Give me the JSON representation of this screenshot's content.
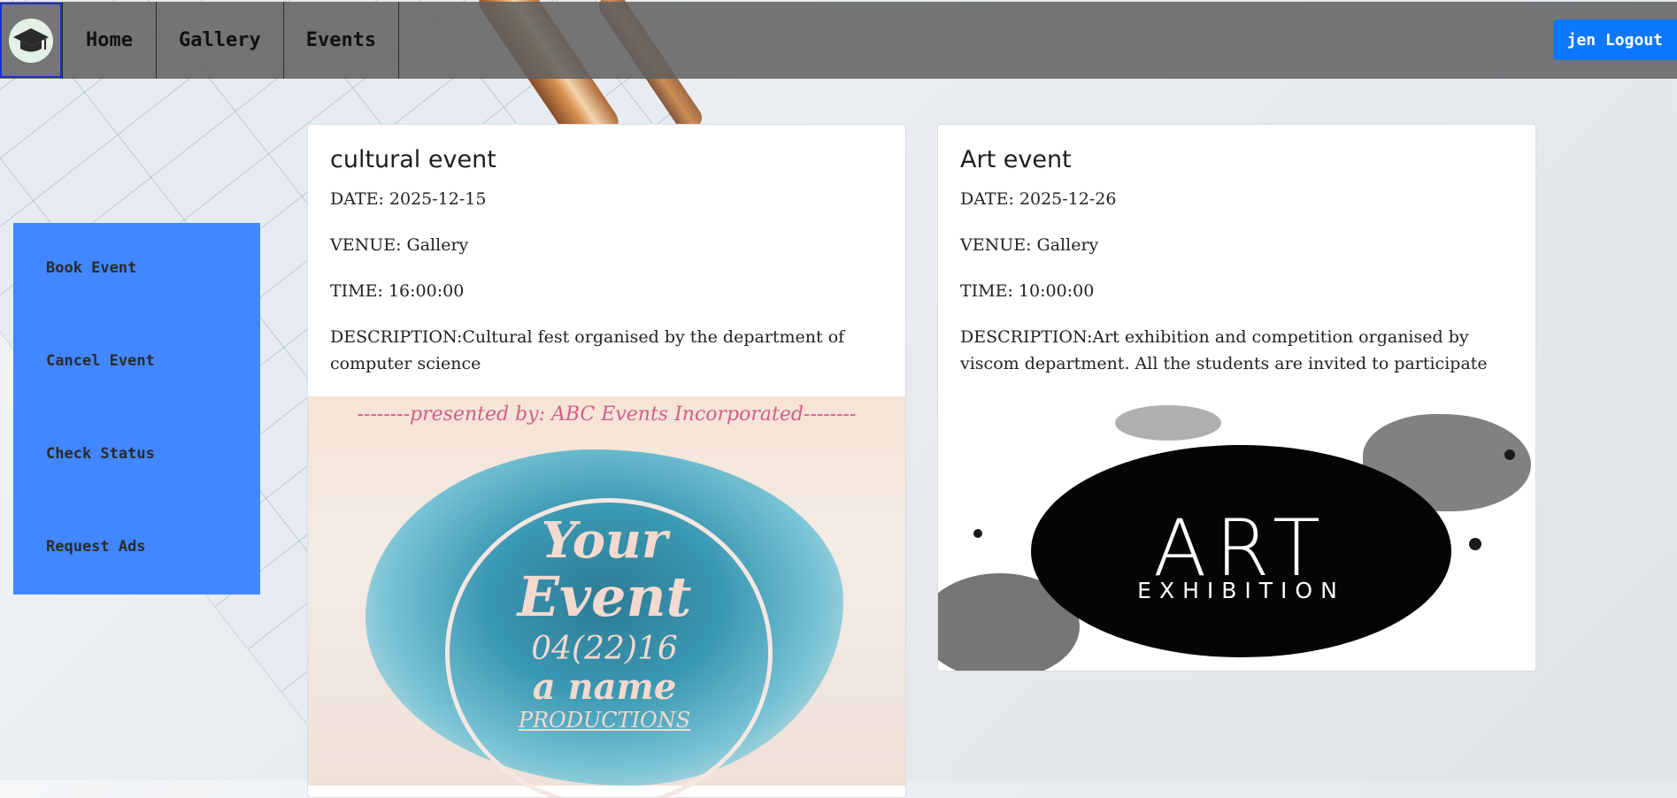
{
  "nav": {
    "logo_icon": "graduation-cap-icon",
    "links": [
      "Home",
      "Gallery",
      "Events"
    ],
    "logout_label": "jen Logout",
    "accent": "#0d78ff"
  },
  "sidebar": {
    "color": "#4287ff",
    "items": [
      "Book Event",
      "Cancel Event",
      "Check Status",
      "Request Ads"
    ]
  },
  "events": [
    {
      "title": "cultural event",
      "date": "DATE: 2025-12-15",
      "venue": "VENUE: Gallery",
      "time": "TIME: 16:00:00",
      "description": "DESCRIPTION:Cultural fest organised by the department of computer science",
      "poster": {
        "top_line": "--------presented by: ABC Events Incorporated--------",
        "line1": "Your",
        "line2": "Event",
        "date": "04(22)16",
        "line3": "a name",
        "line4": "PRODUCTIONS"
      }
    },
    {
      "title": "Art event",
      "date": "DATE: 2025-12-26",
      "venue": "VENUE: Gallery",
      "time": "TIME: 10:00:00",
      "description": "DESCRIPTION:Art exhibition and competition organised by viscom department. All the students are invited to participate",
      "poster": {
        "word": "ART",
        "sub": "EXHIBITION"
      }
    }
  ]
}
